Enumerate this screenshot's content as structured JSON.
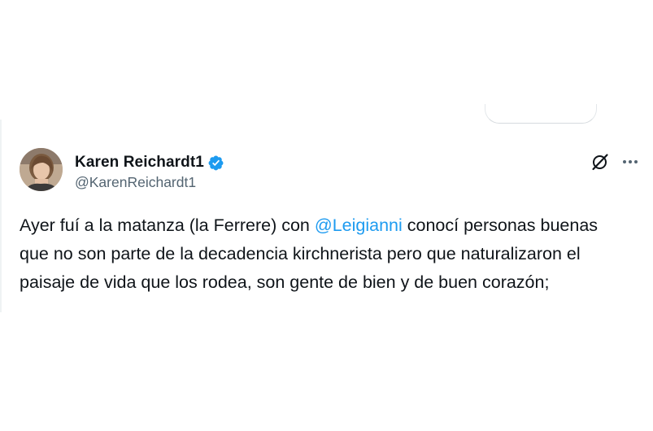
{
  "author": {
    "display_name": "Karen Reichardt1",
    "handle": "@KarenReichardt1",
    "verified": true
  },
  "tweet": {
    "line1_before": "Ayer fuí a la matanza (la Ferrere) con ",
    "mention": "@Leigianni",
    "line1_after": " conocí personas buenas",
    "line2": "que no son parte de la decadencia kirchnerista pero que naturalizaron el",
    "line3": "paisaje de vida que los rodea, son gente de bien y de buen corazón;"
  },
  "icons": {
    "avatar": "profile-photo",
    "verified": "verified-badge-icon",
    "grok": "grok-icon",
    "more": "more-options-icon"
  },
  "colors": {
    "text": "#0f1419",
    "secondary_text": "#536471",
    "accent": "#1d9bf0",
    "background": "#ffffff"
  }
}
